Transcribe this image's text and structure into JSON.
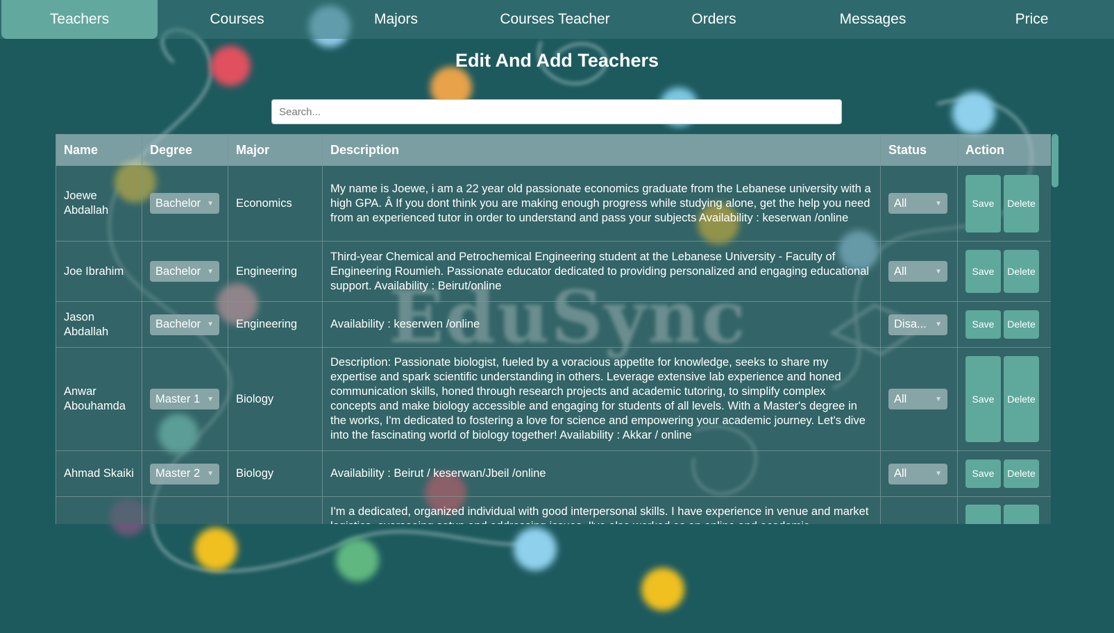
{
  "nav": {
    "tabs": [
      {
        "label": "Teachers",
        "active": true
      },
      {
        "label": "Courses"
      },
      {
        "label": "Majors"
      },
      {
        "label": "Courses Teacher"
      },
      {
        "label": "Orders"
      },
      {
        "label": "Messages"
      },
      {
        "label": "Price"
      }
    ]
  },
  "page": {
    "title": "Edit And Add Teachers",
    "watermark": "EduSync"
  },
  "search": {
    "placeholder": "Search..."
  },
  "table": {
    "headers": [
      "Name",
      "Degree",
      "Major",
      "Description",
      "Status",
      "Action"
    ],
    "rows": [
      {
        "name": "Joewe Abdallah",
        "degree": "Bachelor",
        "major": "Economics",
        "description": "My name is Joewe, i am a 22 year old passionate economics graduate from the Lebanese university with a high GPA. Â If you dont think you are making enough progress while studying alone, get the help you need from an experienced tutor in order to understand and pass your subjects Availability : keserwan /online",
        "status": "All",
        "save": "Save",
        "delete": "Delete"
      },
      {
        "name": "Joe Ibrahim",
        "degree": "Bachelor",
        "major": "Engineering",
        "description": "Third-year Chemical and Petrochemical Engineering student at the Lebanese University - Faculty of Engineering Roumieh. Passionate educator dedicated to providing personalized and engaging educational support. Availability : Beirut/online",
        "status": "All",
        "save": "Save",
        "delete": "Delete"
      },
      {
        "name": "Jason Abdallah",
        "degree": "Bachelor",
        "major": "Engineering",
        "description": "Availability : keserwen /online",
        "status": "Disa...",
        "save": "Save",
        "delete": "Delete"
      },
      {
        "name": "Anwar Abouhamda",
        "degree": "Master 1",
        "major": "Biology",
        "description": "Description: Passionate biologist, fueled by a voracious appetite for knowledge, seeks to share my expertise and spark scientific understanding in others. Leverage extensive lab experience and honed communication skills, honed through research projects and academic tutoring, to simplify complex concepts and make biology accessible and engaging for students of all levels. With a Master's degree in the works, I'm dedicated to fostering a love for science and empowering your academic journey. Let's dive into the fascinating world of biology together!  Availability : Akkar / online",
        "status": "All",
        "save": "Save",
        "delete": "Delete"
      },
      {
        "name": "Ahmad Skaiki",
        "degree": "Master 2",
        "major": "Biology",
        "description": "Availability : Beirut / keserwan/Jbeil /online",
        "status": "All",
        "save": "Save",
        "delete": "Delete"
      },
      {
        "name": "",
        "degree": "",
        "major": "",
        "description": "I'm a dedicated, organized individual with good interpersonal skills. I have experience in venue and market logistics, overseeing setup and addressing issues. I've also worked as an online and academic",
        "status": "",
        "save": "",
        "delete": ""
      }
    ]
  }
}
